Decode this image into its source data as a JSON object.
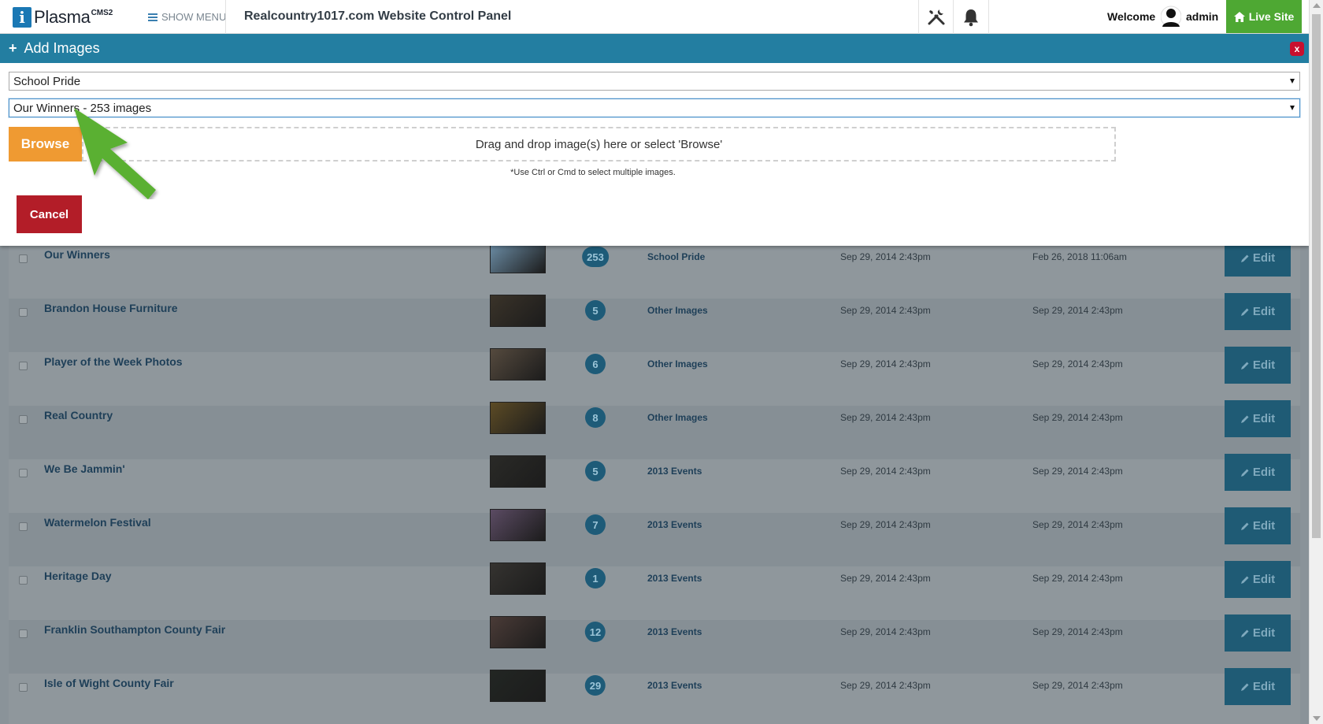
{
  "topbar": {
    "logo_text": "Plasma",
    "logo_superscript": "CMS2",
    "show_menu_label": "SHOW MENU",
    "panel_title": "Realcountry1017.com Website Control Panel",
    "welcome_label": "Welcome",
    "username": "admin",
    "live_site_label": "Live Site",
    "icons": [
      "tools-icon",
      "bell-icon",
      "user-avatar-icon",
      "home-icon"
    ]
  },
  "modal": {
    "title": "Add Images",
    "close_label": "x",
    "category_select": {
      "value": "School Pride"
    },
    "gallery_select": {
      "value": "Our Winners - 253 images"
    },
    "browse_label": "Browse",
    "dropzone_text": "Drag and drop image(s) here or select 'Browse'",
    "hint": "*Use Ctrl or Cmd to select multiple images.",
    "cancel_label": "Cancel"
  },
  "galleries": [
    {
      "name": "Our Winners",
      "count": "253",
      "category": "School Pride",
      "created": "Sep 29, 2014 2:43pm",
      "updated": "Feb 26, 2018 11:06am",
      "edit": "Edit",
      "thumb_color": "#6d8fa8"
    },
    {
      "name": "Brandon House Furniture",
      "count": "5",
      "category": "Other Images",
      "created": "Sep 29, 2014 2:43pm",
      "updated": "Sep 29, 2014 2:43pm",
      "edit": "Edit",
      "thumb_color": "#3a3329"
    },
    {
      "name": "Player of the Week Photos",
      "count": "6",
      "category": "Other Images",
      "created": "Sep 29, 2014 2:43pm",
      "updated": "Sep 29, 2014 2:43pm",
      "edit": "Edit",
      "thumb_color": "#554a3e"
    },
    {
      "name": "Real Country",
      "count": "8",
      "category": "Other Images",
      "created": "Sep 29, 2014 2:43pm",
      "updated": "Sep 29, 2014 2:43pm",
      "edit": "Edit",
      "thumb_color": "#5c4b25"
    },
    {
      "name": "We Be Jammin'",
      "count": "5",
      "category": "2013 Events",
      "created": "Sep 29, 2014 2:43pm",
      "updated": "Sep 29, 2014 2:43pm",
      "edit": "Edit",
      "thumb_color": "#2a2a27"
    },
    {
      "name": "Watermelon Festival",
      "count": "7",
      "category": "2013 Events",
      "created": "Sep 29, 2014 2:43pm",
      "updated": "Sep 29, 2014 2:43pm",
      "edit": "Edit",
      "thumb_color": "#5b4b63"
    },
    {
      "name": "Heritage Day",
      "count": "1",
      "category": "2013 Events",
      "created": "Sep 29, 2014 2:43pm",
      "updated": "Sep 29, 2014 2:43pm",
      "edit": "Edit",
      "thumb_color": "#353330"
    },
    {
      "name": "Franklin Southampton County Fair",
      "count": "12",
      "category": "2013 Events",
      "created": "Sep 29, 2014 2:43pm",
      "updated": "Sep 29, 2014 2:43pm",
      "edit": "Edit",
      "thumb_color": "#4a3b37"
    },
    {
      "name": "Isle of Wight County Fair",
      "count": "29",
      "category": "2013 Events",
      "created": "Sep 29, 2014 2:43pm",
      "updated": "Sep 29, 2014 2:43pm",
      "edit": "Edit",
      "thumb_color": "#222623"
    }
  ],
  "colors": {
    "header_blue": "#237ea1",
    "browse_orange": "#ef9a32",
    "cancel_red": "#b31d28",
    "live_green": "#4ea833",
    "arrow_green": "#5ab031"
  }
}
